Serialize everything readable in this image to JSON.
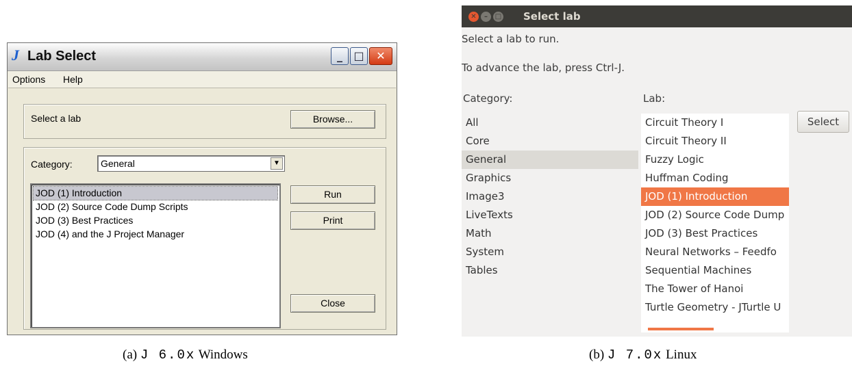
{
  "windows_dialog": {
    "title": "Lab Select",
    "logo_text": "J",
    "menu": [
      "Options",
      "Help"
    ],
    "select_prompt": "Select a lab",
    "browse_label": "Browse...",
    "category_label": "Category:",
    "category_value": "General",
    "labs": [
      "JOD (1) Introduction",
      "JOD (2) Source Code Dump Scripts",
      "JOD (3) Best Practices",
      "JOD (4) and the J Project Manager"
    ],
    "selected_lab_index": 0,
    "run_label": "Run",
    "print_label": "Print",
    "close_label": "Close"
  },
  "linux_dialog": {
    "title": "Select lab",
    "instruction_1": "Select a lab to run.",
    "instruction_2": "To advance the lab, press Ctrl-J.",
    "category_header": "Category:",
    "lab_header": "Lab:",
    "categories": [
      "All",
      "Core",
      "General",
      "Graphics",
      "Image3",
      "LiveTexts",
      "Math",
      "System",
      "Tables"
    ],
    "selected_category_index": 2,
    "labs": [
      "Circuit Theory I",
      "Circuit Theory II",
      "Fuzzy Logic",
      "Huffman Coding",
      "JOD (1) Introduction",
      "JOD (2) Source Code Dump",
      "JOD (3) Best Practices",
      "Neural Networks – Feedfo",
      "Sequential Machines",
      "The Tower of Hanoi",
      "Turtle Geometry - JTurtle U"
    ],
    "selected_lab_index": 4,
    "select_button_label": "Select"
  },
  "captions": {
    "a_prefix": "(a)",
    "a_version": "J 6.0x",
    "a_suffix": "Windows",
    "b_prefix": "(b)",
    "b_version": "J 7.0x",
    "b_suffix": "Linux"
  }
}
